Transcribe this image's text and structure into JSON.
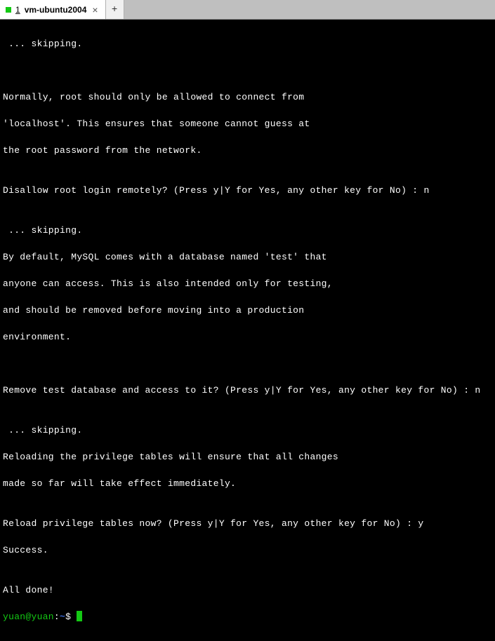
{
  "tabbar": {
    "tabs": [
      {
        "number": "1",
        "title": "vm-ubuntu2004",
        "close_glyph": "×"
      }
    ],
    "new_tab_glyph": "+"
  },
  "terminal": {
    "lines": {
      "l0": " ... skipping.",
      "l1": "",
      "l2": "",
      "l3": "Normally, root should only be allowed to connect from",
      "l4": "'localhost'. This ensures that someone cannot guess at",
      "l5": "the root password from the network.",
      "l6": "",
      "l7": "Disallow root login remotely? (Press y|Y for Yes, any other key for No) : n",
      "l8": "",
      "l9": " ... skipping.",
      "l10": "By default, MySQL comes with a database named 'test' that",
      "l11": "anyone can access. This is also intended only for testing,",
      "l12": "and should be removed before moving into a production",
      "l13": "environment.",
      "l14": "",
      "l15": "",
      "l16": "Remove test database and access to it? (Press y|Y for Yes, any other key for No) : n",
      "l17": "",
      "l18": " ... skipping.",
      "l19": "Reloading the privilege tables will ensure that all changes",
      "l20": "made so far will take effect immediately.",
      "l21": "",
      "l22": "Reload privilege tables now? (Press y|Y for Yes, any other key for No) : y",
      "l23": "Success.",
      "l24": "",
      "l25": "All done!"
    },
    "prompt": {
      "user_host": "yuan@yuan",
      "colon": ":",
      "path": "~",
      "sigil": "$ "
    }
  }
}
